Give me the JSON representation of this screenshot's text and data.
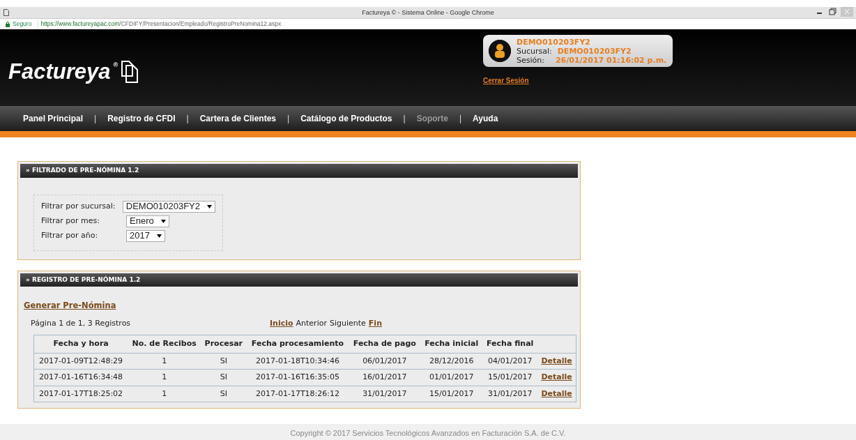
{
  "window": {
    "title": "Factureya © - Sistema Online - Google Chrome"
  },
  "address_bar": {
    "security": "Seguro",
    "url_host": "https://www.factureyapac.com",
    "url_path": "/CFDIFY/Presentacion/Empleado/RegistroPreNomina12.aspx"
  },
  "header": {
    "logo": "Factureya",
    "logo_mark": "®",
    "user": {
      "name": "DEMO010203FY2",
      "branch_label": "Sucursal:",
      "branch": "DEMO010203FY2",
      "session_label": "Sesión:",
      "session": "26/01/2017 01:16:02 p.m."
    },
    "logout": "Cerrar Sesión"
  },
  "nav": [
    {
      "label": "Panel Principal",
      "disabled": false
    },
    {
      "label": "Registro de CFDI",
      "disabled": false
    },
    {
      "label": "Cartera de Clientes",
      "disabled": false
    },
    {
      "label": "Catálogo de Productos",
      "disabled": false
    },
    {
      "label": "Soporte",
      "disabled": true
    },
    {
      "label": "Ayuda",
      "disabled": false
    }
  ],
  "nav_separator": "|",
  "filter_panel": {
    "title": "» FILTRADO DE PRE-NÓMINA 1.2",
    "filters": [
      {
        "label": "Filtrar por sucursal:",
        "value": "DEMO010203FY2"
      },
      {
        "label": "Filtrar por mes:",
        "value": "Enero"
      },
      {
        "label": "Filtrar por año:",
        "value": "2017"
      }
    ]
  },
  "register_panel": {
    "title": "» REGISTRO DE PRE-NÓMINA 1.2",
    "generate_link": "Generar Pre-Nómina",
    "page_info": "Página 1 de 1, 3 Registros",
    "pager": [
      {
        "label": "Inicio",
        "enabled": true
      },
      {
        "label": "Anterior",
        "enabled": false
      },
      {
        "label": "Siguiente",
        "enabled": false
      },
      {
        "label": "Fin",
        "enabled": true
      }
    ],
    "table": {
      "columns": [
        "Fecha y hora",
        "No. de Recibos",
        "Procesar",
        "Fecha procesamiento",
        "Fecha de pago",
        "Fecha inicial",
        "Fecha final"
      ],
      "rows": [
        {
          "cells": [
            "2017-01-09T12:48:29",
            "1",
            "SI",
            "2017-01-18T10:34:46",
            "06/01/2017",
            "28/12/2016",
            "04/01/2017"
          ],
          "action": "Detalle"
        },
        {
          "cells": [
            "2017-01-16T16:34:48",
            "1",
            "SI",
            "2017-01-16T16:35:05",
            "16/01/2017",
            "01/01/2017",
            "15/01/2017"
          ],
          "action": "Detalle"
        },
        {
          "cells": [
            "2017-01-17T18:25:02",
            "1",
            "SI",
            "2017-01-17T18:26:12",
            "31/01/2017",
            "15/01/2017",
            "31/01/2017"
          ],
          "action": "Detalle"
        }
      ]
    }
  },
  "footer": "Copyright © 2017 Servicios Tecnológicos Avanzados en Facturación S.A. de C.V."
}
